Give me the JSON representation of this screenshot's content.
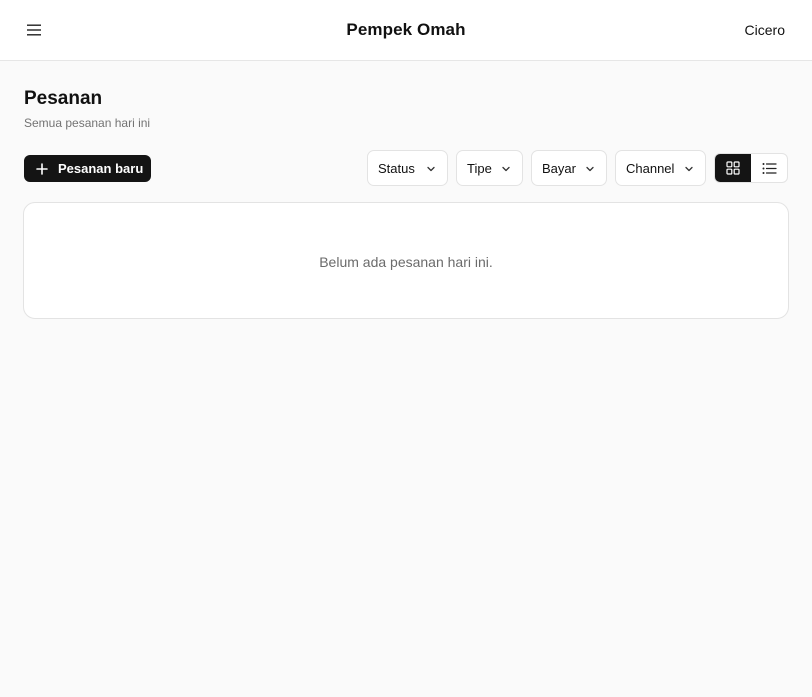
{
  "header": {
    "menu_icon": "hamburger-menu-icon",
    "title": "Pempek Omah",
    "user": "Cicero"
  },
  "page": {
    "title": "Pesanan",
    "subtitle": "Semua pesanan hari ini"
  },
  "toolbar": {
    "new_order_label": "Pesanan baru",
    "new_order_icon": "plus-icon",
    "filters": [
      {
        "label": "Status",
        "icon": "chevron-down-icon"
      },
      {
        "label": "Tipe",
        "icon": "chevron-down-icon"
      },
      {
        "label": "Bayar",
        "icon": "chevron-down-icon"
      },
      {
        "label": "Channel",
        "icon": "chevron-down-icon"
      }
    ],
    "view_modes": [
      {
        "icon": "grid-view-icon",
        "active": true
      },
      {
        "icon": "list-view-icon",
        "active": false
      }
    ]
  },
  "orders": {
    "empty_message": "Belum ada pesanan hari ini."
  },
  "colors": {
    "background": "#fafafa",
    "surface": "#ffffff",
    "primary": "#141414",
    "border": "#e3e3e3",
    "muted_text": "#6b6b6b"
  }
}
